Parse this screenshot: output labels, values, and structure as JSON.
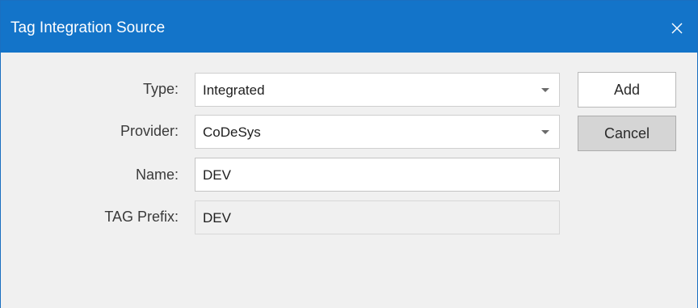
{
  "dialog": {
    "title": "Tag Integration Source",
    "close_glyph": "✕"
  },
  "form": {
    "type": {
      "label": "Type:",
      "value": "Integrated"
    },
    "provider": {
      "label": "Provider:",
      "value": "CoDeSys"
    },
    "name": {
      "label": "Name:",
      "value": "DEV"
    },
    "tag_prefix": {
      "label": "TAG Prefix:",
      "value": "DEV"
    }
  },
  "buttons": {
    "add_label": "Add",
    "cancel_label": "Cancel"
  },
  "colors": {
    "titlebar": "#1374c9",
    "background": "#f0f0f0"
  },
  "icons": {
    "close": "close-icon",
    "dropdown": "chevron-down-icon"
  }
}
